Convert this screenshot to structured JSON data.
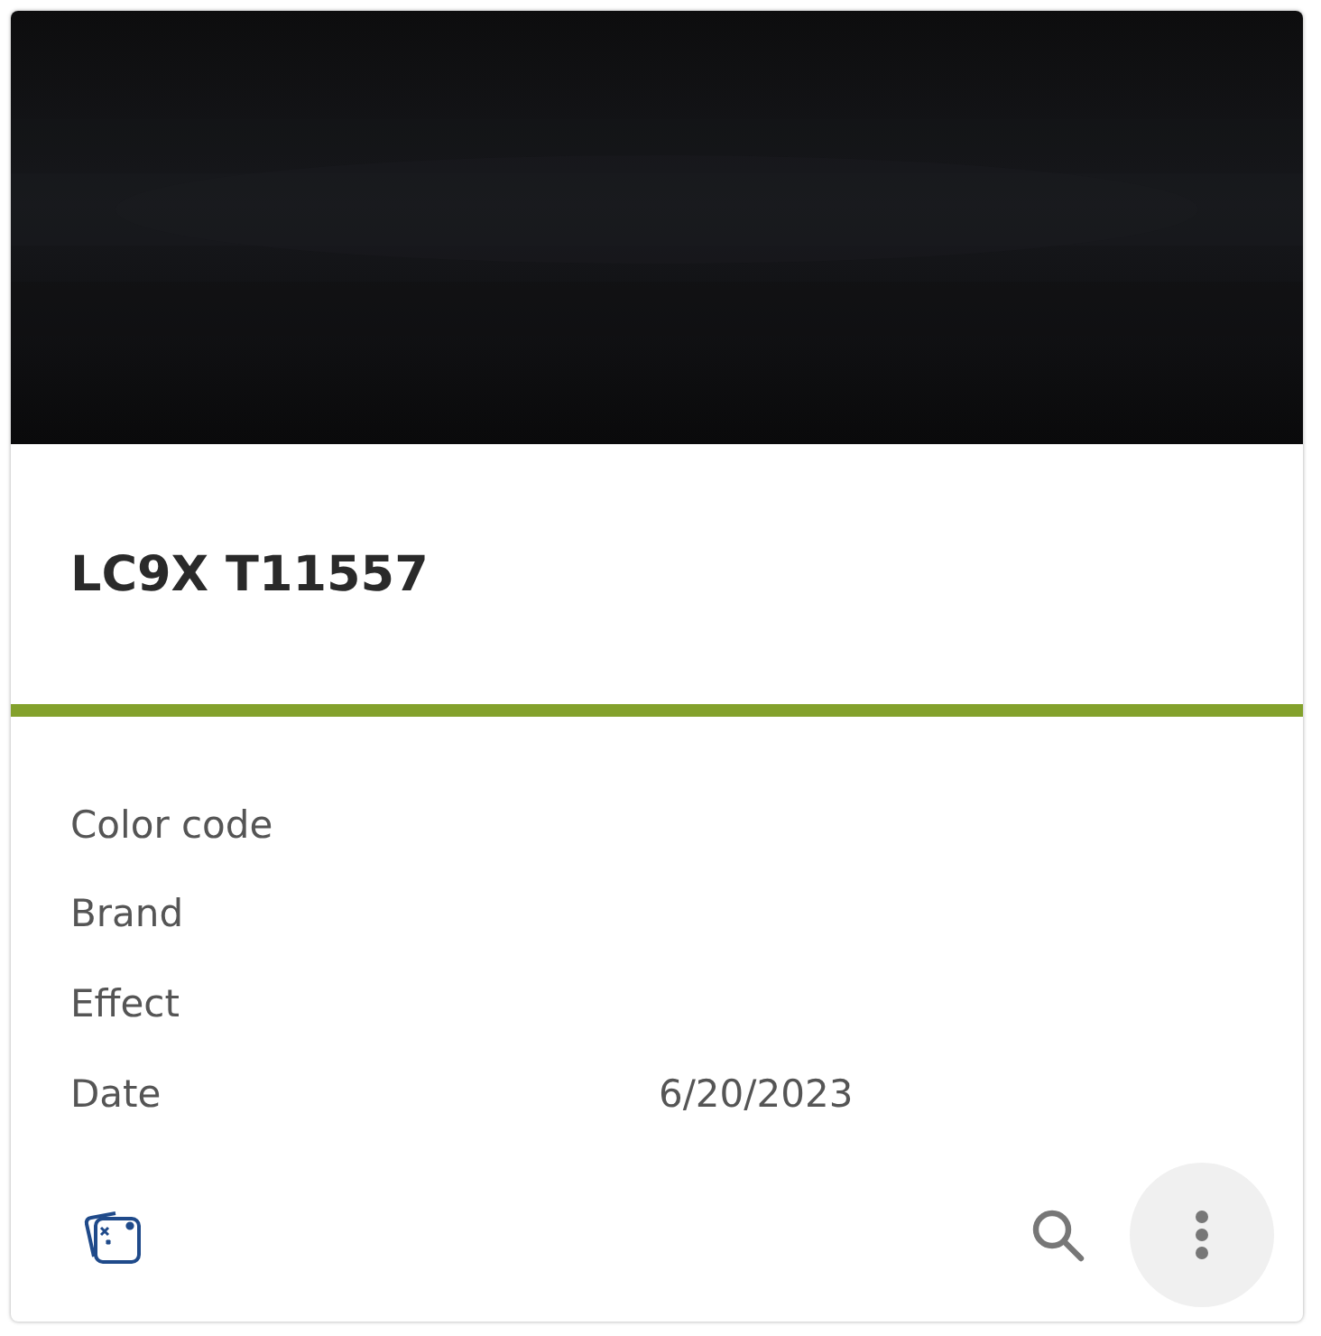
{
  "card": {
    "title": "LC9X T11557",
    "fields": [
      {
        "label": "Color code"
      },
      {
        "label": "Brand"
      },
      {
        "label": "Effect"
      },
      {
        "label": "Date",
        "value": "6/20/2023"
      }
    ]
  }
}
